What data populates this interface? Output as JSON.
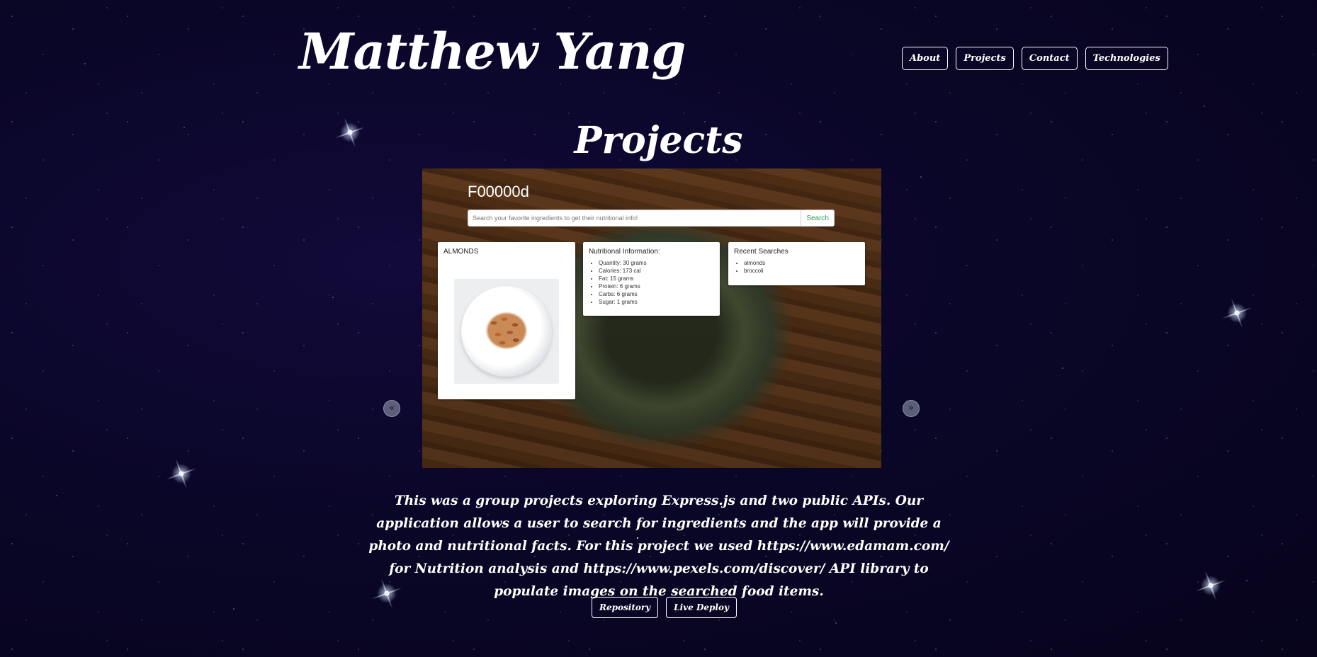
{
  "site": {
    "title": "Matthew Yang"
  },
  "nav": [
    {
      "label": "About"
    },
    {
      "label": "Projects"
    },
    {
      "label": "Contact"
    },
    {
      "label": "Technologies"
    }
  ],
  "section": {
    "title": "Projects"
  },
  "carousel": {
    "prev_icon": "chevron-left-icon",
    "next_icon": "chevron-right-icon",
    "slide": {
      "app_name": "F00000d",
      "search_placeholder": "Search your favorite ingredients to get their nutritional info!",
      "search_button": "Search",
      "result_card": {
        "title": "ALMONDS"
      },
      "nutrition_card": {
        "title": "Nutritional Information:",
        "items": [
          "Quantity: 30 grams",
          "Calories: 173 cal",
          "Fat: 15 grams",
          "Protein: 6 grams",
          "Carbs: 6 grams",
          "Sugar: 1 grams"
        ]
      },
      "recent_card": {
        "title": "Recent Searches",
        "items": [
          "almonds",
          "broccoli"
        ]
      }
    }
  },
  "project": {
    "description": "This was a group projects exploring Express.js and two public APIs. Our application allows a user to search for ingredients and the app will provide a photo and nutritional facts. For this project we used https://www.edamam.com/ for Nutrition analysis and https://www.pexels.com/discover/ API library to populate images on the searched food items.",
    "repo_label": "Repository",
    "deploy_label": "Live Deploy"
  }
}
